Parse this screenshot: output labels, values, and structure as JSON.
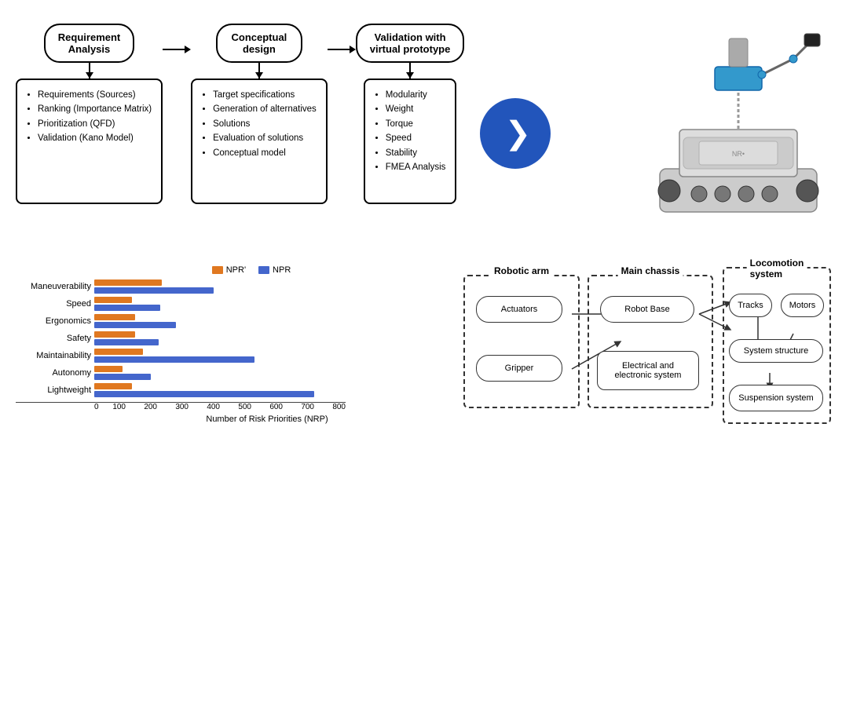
{
  "flowchart": {
    "nodes": [
      {
        "id": "req",
        "top_label": "Requirement\nAnalysis",
        "items": [
          "Requirements (Sources)",
          "Ranking (Importance Matrix)",
          "Prioritization (QFD)",
          "Validation (Kano Model)"
        ]
      },
      {
        "id": "concept",
        "top_label": "Conceptual\ndesign",
        "items": [
          "Target specifications",
          "Generation of alternatives",
          "Solutions",
          "Evaluation of solutions",
          "Conceptual model"
        ]
      },
      {
        "id": "valid",
        "top_label": "Validation with\nvirtual prototype",
        "items": [
          "Modularity",
          "Weight",
          "Torque",
          "Speed",
          "Stability",
          "FMEA Analysis"
        ]
      }
    ]
  },
  "chart": {
    "title": "Number of Risk Priorities (NRP)",
    "x_axis_label": "Number of Risk Priorities (NRP)",
    "x_ticks": [
      "0",
      "100",
      "200",
      "300",
      "400",
      "500",
      "600",
      "700",
      "800"
    ],
    "scale_max": 800,
    "legend": {
      "orange_label": "NPR'",
      "blue_label": "NPR"
    },
    "rows": [
      {
        "label": "Maneuverability",
        "orange": 215,
        "blue": 380
      },
      {
        "label": "Speed",
        "orange": 120,
        "blue": 210
      },
      {
        "label": "Ergonomics",
        "orange": 130,
        "blue": 260
      },
      {
        "label": "Safety",
        "orange": 130,
        "blue": 205
      },
      {
        "label": "Maintainability",
        "orange": 155,
        "blue": 510
      },
      {
        "label": "Autonomy",
        "orange": 90,
        "blue": 180
      },
      {
        "label": "Lightweight",
        "orange": 120,
        "blue": 700
      }
    ]
  },
  "system_diagram": {
    "groups": [
      {
        "id": "robotic_arm",
        "label": "Robotic arm"
      },
      {
        "id": "main_chassis",
        "label": "Main chassis"
      },
      {
        "id": "locomotion",
        "label": "Locomotion\nsystem"
      }
    ],
    "nodes": [
      {
        "id": "actuators",
        "label": "Actuators"
      },
      {
        "id": "gripper",
        "label": "Gripper"
      },
      {
        "id": "robot_base",
        "label": "Robot Base"
      },
      {
        "id": "electrical",
        "label": "Electrical and\nelectronic system"
      },
      {
        "id": "tracks",
        "label": "Tracks"
      },
      {
        "id": "motors",
        "label": "Motors"
      },
      {
        "id": "sys_structure",
        "label": "System structure"
      },
      {
        "id": "suspension",
        "label": "Suspension system"
      }
    ]
  },
  "colors": {
    "accent_blue": "#2255bb",
    "bar_orange": "#e07820",
    "bar_blue": "#4466cc"
  }
}
